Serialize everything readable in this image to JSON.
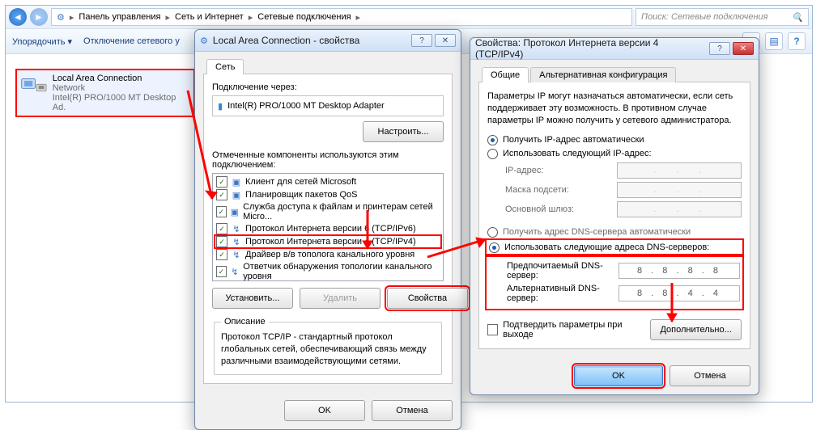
{
  "explorer": {
    "breadcrumbs": [
      "Панель управления",
      "Сеть и Интернет",
      "Сетевые подключения"
    ],
    "search_placeholder": "Поиск: Сетевые подключения",
    "toolbar_sort": "Упорядочить",
    "toolbar_disable": "Отключение сетевого у"
  },
  "connection": {
    "name": "Local Area Connection",
    "status": "Network",
    "adapter": "Intel(R) PRO/1000 MT Desktop Ad."
  },
  "lacProps": {
    "title": "Local Area Connection - свойства",
    "tab_network": "Сеть",
    "connect_using": "Подключение через:",
    "adapter_full": "Intel(R) PRO/1000 MT Desktop Adapter",
    "configure": "Настроить...",
    "components_label": "Отмеченные компоненты используются этим подключением:",
    "components": [
      "Клиент для сетей Microsoft",
      "Планировщик пакетов QoS",
      "Служба доступа к файлам и принтерам сетей Micro...",
      "Протокол Интернета версии 6 (TCP/IPv6)",
      "Протокол Интернета версии 4 (TCP/IPv4)",
      "Драйвер в/в тополога канального уровня",
      "Ответчик обнаружения топологии канального уровня"
    ],
    "install": "Установить...",
    "uninstall": "Удалить",
    "properties": "Свойства",
    "desc_heading": "Описание",
    "desc_text": "Протокол TCP/IP - стандартный протокол глобальных сетей, обеспечивающий связь между различными взаимодействующими сетями.",
    "ok": "OK",
    "cancel": "Отмена"
  },
  "ipv4": {
    "title": "Свойства: Протокол Интернета версии 4 (TCP/IPv4)",
    "tab_general": "Общие",
    "tab_alt": "Альтернативная конфигурация",
    "intro": "Параметры IP могут назначаться автоматически, если сеть поддерживает эту возможность. В противном случае параметры IP можно получить у сетевого администратора.",
    "ip_auto": "Получить IP-адрес автоматически",
    "ip_manual": "Использовать следующий IP-адрес:",
    "ip_addr": "IP-адрес:",
    "ip_mask": "Маска подсети:",
    "ip_gw": "Основной шлюз:",
    "dns_auto": "Получить адрес DNS-сервера автоматически",
    "dns_manual": "Использовать следующие адреса DNS-серверов:",
    "dns_pref_lbl": "Предпочитаемый DNS-сервер:",
    "dns_alt_lbl": "Альтернативный DNS-сервер:",
    "dns_pref": "8 . 8 . 8 . 8",
    "dns_alt": "8 . 8 . 4 . 4",
    "validate": "Подтвердить параметры при выходе",
    "advanced": "Дополнительно...",
    "ok": "OK",
    "cancel": "Отмена"
  }
}
